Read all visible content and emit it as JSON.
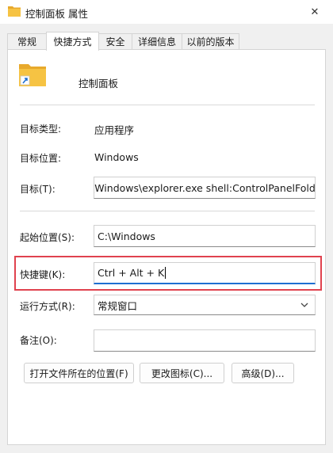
{
  "window": {
    "title": "控制面板 属性",
    "close_symbol": "✕"
  },
  "tabs": [
    {
      "label": "常规",
      "active": false
    },
    {
      "label": "快捷方式",
      "active": true
    },
    {
      "label": "安全",
      "active": false
    },
    {
      "label": "详细信息",
      "active": false
    },
    {
      "label": "以前的版本",
      "active": false
    }
  ],
  "header": {
    "name": "控制面板",
    "icon": "folder-shortcut-icon"
  },
  "fields": {
    "target_type": {
      "label": "目标类型:",
      "value": "应用程序"
    },
    "target_location": {
      "label": "目标位置:",
      "value": "Windows"
    },
    "target": {
      "label": "目标(T):",
      "value": "\\Windows\\explorer.exe shell:ControlPanelFolder"
    },
    "start_in": {
      "label": "起始位置(S):",
      "value": "C:\\Windows"
    },
    "shortcut_key": {
      "label": "快捷键(K):",
      "value": "Ctrl + Alt + K"
    },
    "run": {
      "label": "运行方式(R):",
      "value": "常规窗口"
    },
    "comment": {
      "label": "备注(O):",
      "value": ""
    }
  },
  "buttons": {
    "open_location": "打开文件所在的位置(F)",
    "change_icon": "更改图标(C)...",
    "advanced": "高级(D)..."
  },
  "colors": {
    "highlight": "#e0424e",
    "folder": "#f6c343"
  }
}
